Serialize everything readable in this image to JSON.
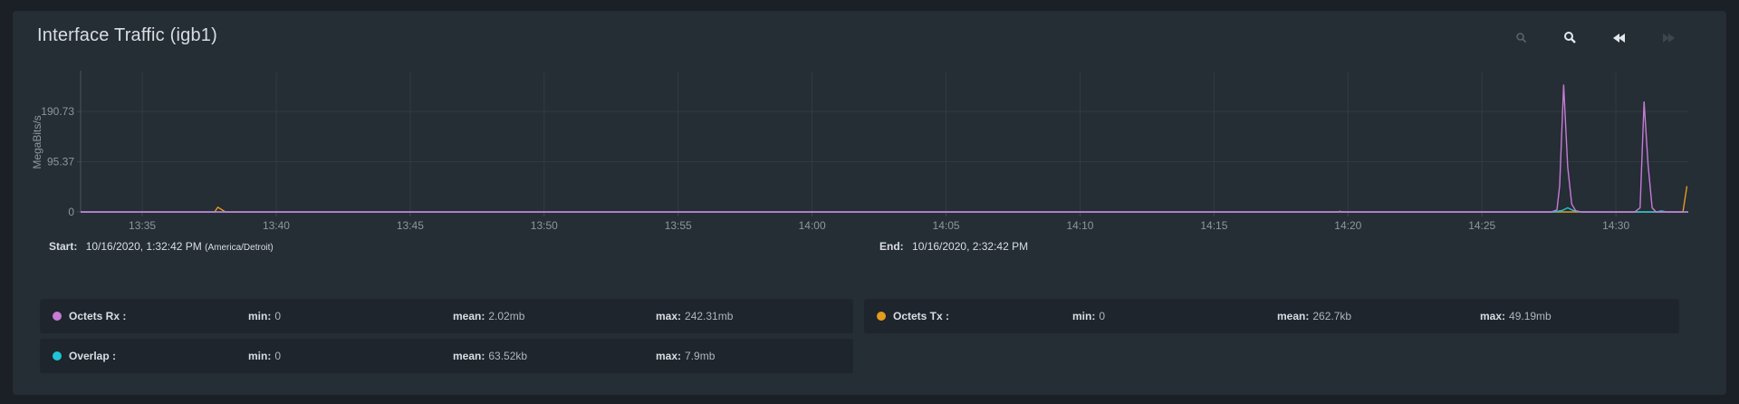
{
  "panel": {
    "title": "Interface Traffic (igb1)"
  },
  "toolbar": {
    "icons": [
      "zoom-in-icon",
      "zoom-out-icon",
      "rewind-icon",
      "forward-icon"
    ]
  },
  "range": {
    "start_label": "Start:",
    "start_value": "10/16/2020, 1:32:42 PM",
    "start_tz": "(America/Detroit)",
    "end_label": "End:",
    "end_value": "10/16/2020, 2:32:42 PM"
  },
  "legend": {
    "min_label": "min:",
    "mean_label": "mean:",
    "max_label": "max:",
    "items": [
      {
        "name": "Octets Rx :",
        "color": "#c67bd6",
        "min": "0",
        "mean": "2.02mb",
        "max": "242.31mb"
      },
      {
        "name": "Octets Tx :",
        "color": "#e59b1b",
        "min": "0",
        "mean": "262.7kb",
        "max": "49.19mb"
      },
      {
        "name": "Overlap :",
        "color": "#20c4d8",
        "min": "0",
        "mean": "63.52kb",
        "max": "7.9mb"
      }
    ]
  },
  "chart_data": {
    "type": "line",
    "ylabel": "MegaBits/s",
    "yticks": [
      0,
      95.37,
      190.73
    ],
    "ytick_labels": [
      "0",
      "95.37",
      "190.73"
    ],
    "ylim": [
      0,
      265
    ],
    "xlim_minutes": [
      0,
      60
    ],
    "xticks": [
      "13:35",
      "13:40",
      "13:45",
      "13:50",
      "13:55",
      "14:00",
      "14:05",
      "14:10",
      "14:15",
      "14:20",
      "14:25",
      "14:30"
    ],
    "xtick_minutes": [
      2.3,
      7.3,
      12.3,
      17.3,
      22.3,
      27.3,
      32.3,
      37.3,
      42.3,
      47.3,
      52.3,
      57.3
    ],
    "grid": true,
    "series": [
      {
        "name": "Octets Rx",
        "color": "#c67bd6",
        "points": [
          [
            0,
            0
          ],
          [
            54.9,
            0
          ],
          [
            55.1,
            4
          ],
          [
            55.2,
            50
          ],
          [
            55.35,
            242
          ],
          [
            55.5,
            85
          ],
          [
            55.65,
            15
          ],
          [
            55.8,
            2
          ],
          [
            56.0,
            0
          ],
          [
            58.0,
            0
          ],
          [
            58.2,
            8
          ],
          [
            58.35,
            210
          ],
          [
            58.5,
            90
          ],
          [
            58.65,
            8
          ],
          [
            58.8,
            0
          ],
          [
            60,
            0
          ]
        ]
      },
      {
        "name": "Octets Tx",
        "color": "#e59b1b",
        "points": [
          [
            0,
            0
          ],
          [
            5.0,
            0
          ],
          [
            5.12,
            9
          ],
          [
            5.25,
            5
          ],
          [
            5.4,
            0
          ],
          [
            46.9,
            0
          ],
          [
            47.0,
            1
          ],
          [
            47.1,
            0
          ],
          [
            59.8,
            0
          ],
          [
            59.95,
            49
          ]
        ]
      },
      {
        "name": "Overlap",
        "color": "#20c4d8",
        "points": [
          [
            0,
            0
          ],
          [
            55.0,
            0
          ],
          [
            55.3,
            3
          ],
          [
            55.5,
            7.9
          ],
          [
            55.7,
            3
          ],
          [
            56.0,
            0
          ],
          [
            58.8,
            0
          ],
          [
            59.0,
            2
          ],
          [
            59.2,
            0
          ],
          [
            60,
            0
          ]
        ]
      }
    ]
  }
}
